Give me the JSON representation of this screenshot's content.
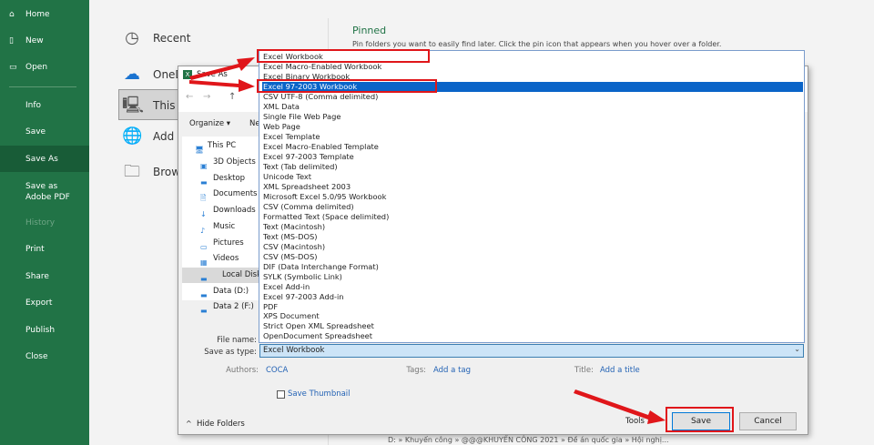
{
  "sidebar": {
    "home": "Home",
    "new": "New",
    "open": "Open",
    "info": "Info",
    "save": "Save",
    "save_as": "Save As",
    "save_adobe": "Save as Adobe PDF",
    "history": "History",
    "print": "Print",
    "share": "Share",
    "export": "Export",
    "publish": "Publish",
    "close": "Close"
  },
  "backstage": {
    "recent": "Recent",
    "onedrive": "OneD",
    "this_pc": "This P",
    "add_place": "Add a",
    "browse": "Brow",
    "pinned_title": "Pinned",
    "pinned_desc": "Pin folders you want to easily find later. Click the pin icon that appears when you hover over a folder.",
    "path": "D: » Khuyến công » @@@KHUYẾN CÔNG 2021 » Đề án quốc gia » Hội nghị..."
  },
  "dialog": {
    "title": "Save As",
    "organize": "Organize ▾",
    "new_folder": "Ne",
    "nav": [
      "This PC",
      "3D Objects",
      "Desktop",
      "Documents",
      "Downloads",
      "Music",
      "Pictures",
      "Videos",
      "Local Disk (C:",
      "Data (D:)",
      "Data 2 (F:)"
    ],
    "file_types": [
      "Excel Workbook",
      "Excel Macro-Enabled Workbook",
      "Excel Binary Workbook",
      "Excel 97-2003 Workbook",
      "CSV UTF-8 (Comma delimited)",
      "XML Data",
      "Single File Web Page",
      "Web Page",
      "Excel Template",
      "Excel Macro-Enabled Template",
      "Excel 97-2003 Template",
      "Text (Tab delimited)",
      "Unicode Text",
      "XML Spreadsheet 2003",
      "Microsoft Excel 5.0/95 Workbook",
      "CSV (Comma delimited)",
      "Formatted Text (Space delimited)",
      "Text (Macintosh)",
      "Text (MS-DOS)",
      "CSV (Macintosh)",
      "CSV (MS-DOS)",
      "DIF (Data Interchange Format)",
      "SYLK (Symbolic Link)",
      "Excel Add-in",
      "Excel 97-2003 Add-in",
      "PDF",
      "XPS Document",
      "Strict Open XML Spreadsheet",
      "OpenDocument Spreadsheet"
    ],
    "selected_index": 3,
    "file_name_label": "File name:",
    "save_type_label": "Save as type:",
    "save_type_value": "Excel Workbook",
    "authors_label": "Authors:",
    "authors_value": "COCA",
    "tags_label": "Tags:",
    "tags_value": "Add a tag",
    "title_label": "Title:",
    "title_value": "Add a title",
    "thumbnail": "Save Thumbnail",
    "hide_folders": "Hide Folders",
    "tools": "Tools",
    "save": "Save",
    "cancel": "Cancel"
  },
  "colors": {
    "green": "#217346",
    "highlight": "#0a64c8",
    "annotation": "#e0161a"
  }
}
